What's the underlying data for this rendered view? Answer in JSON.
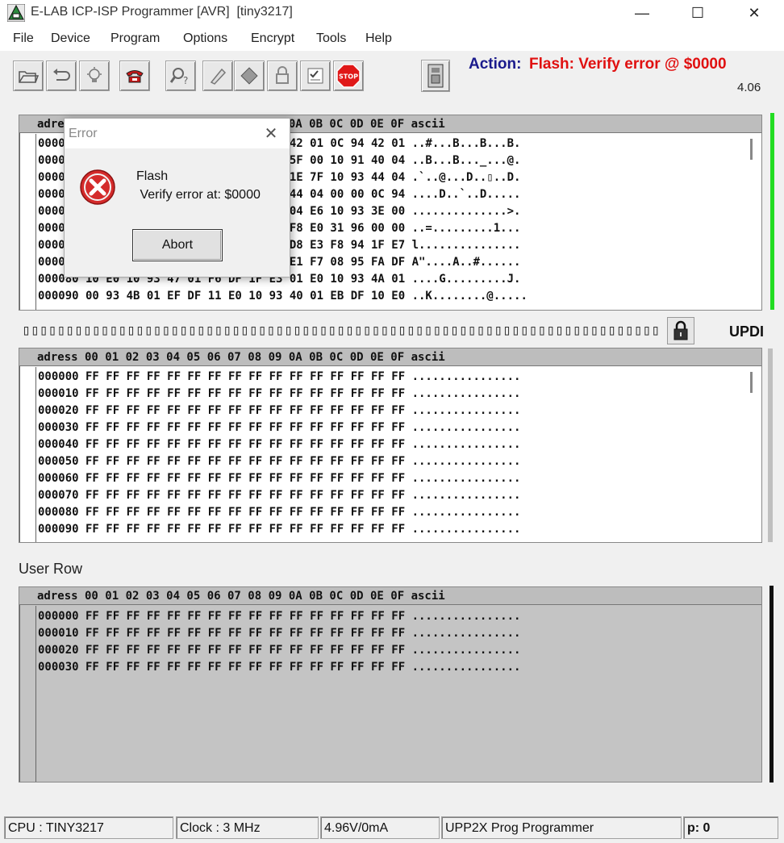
{
  "window": {
    "title": "E-LAB ICP-ISP Programmer [AVR]  [tiny3217]",
    "minimize_glyph": "—",
    "maximize_glyph": "☐",
    "close_glyph": "✕"
  },
  "menu": [
    "File",
    "Device",
    "Program",
    "Options",
    "Encrypt",
    "Tools",
    "Help"
  ],
  "toolbar": {
    "icons": [
      "open-file-icon",
      "reload-icon",
      "lightbulb-icon",
      "phone-icon",
      "search-device-icon",
      "pencil-erase-icon",
      "chip-icon",
      "padlock-icon",
      "checklist-icon",
      "stop-icon",
      "device-panel-icon"
    ],
    "stop_text": "STOP",
    "action_label": "Action:",
    "action_value": "Flash: Verify error @ $0000",
    "version": "4.06"
  },
  "colors": {
    "action_label": "#1a1a8c",
    "action_value": "#e01010",
    "status_ok": "#22dd22"
  },
  "flash_panel": {
    "header": "adress 00 01 02 03 04 05 06 07 08 09 0A 0B 0C 0D 0E 0F ascii",
    "rows": [
      "000000 0C 94 40 00 0C 94 42 01 0C 94 42 01 0C 94 42 01 ..#...B...B...B.",
      "000010 0C 94 42 01 0C 94 42 01 0C 94 5F 00 10 91 40 04 ..B...B..._...@.",
      "000020 0C 94 42 01 0C 94 40 04 44 04 1E 7F 10 93 44 04 .`..@...D..▯..D.",
      "000030 0C 94 42 01 0C 94 60 01 10 93 44 04 00 00 0C 94 ....D..`..D.....",
      "000040 0C 94 42 01 0C 94 42 01 18 E3 04 E6 10 93 3E 00 ..............>.",
      "000050 0C 94 42 01 3D 00 00 00 E0 E0 F8 E0 31 96 00 00 ..=.........1...",
      "000060 0C 94 42 01 0C 94 42 01 C9 ED D8 E3 F8 94 1F E7 l...............",
      "000070 0C 94 42 01 0C 94 42 01 00 23 E1 F7 08 95 FA DF A\"....A..#......",
      "000080 10 E0 10 93 47 01 F6 DF 1F E3 01 E0 10 93 4A 01 ....G.........J.",
      "000090 00 93 4B 01 EF DF 11 E0 10 93 40 01 EB DF 10 E0 ..K........@....."
    ]
  },
  "progress_text": "▯▯▯▯▯▯▯▯▯▯▯▯▯▯▯▯▯▯▯▯▯▯▯▯▯▯▯▯▯▯▯▯▯▯▯▯▯▯▯▯▯▯▯▯▯▯▯▯▯▯▯▯▯▯▯▯▯▯▯▯▯▯▯▯▯▯▯▯▯▯▯▯▯▯▯▯▯▯▯▯▯▯▯▯▯▯▯▯▯▯▯▯▯",
  "interface_label": "UPDI",
  "eeprom_panel": {
    "header": "adress 00 01 02 03 04 05 06 07 08 09 0A 0B 0C 0D 0E 0F ascii",
    "rows": [
      "000000 FF FF FF FF FF FF FF FF FF FF FF FF FF FF FF FF ................",
      "000010 FF FF FF FF FF FF FF FF FF FF FF FF FF FF FF FF ................",
      "000020 FF FF FF FF FF FF FF FF FF FF FF FF FF FF FF FF ................",
      "000030 FF FF FF FF FF FF FF FF FF FF FF FF FF FF FF FF ................",
      "000040 FF FF FF FF FF FF FF FF FF FF FF FF FF FF FF FF ................",
      "000050 FF FF FF FF FF FF FF FF FF FF FF FF FF FF FF FF ................",
      "000060 FF FF FF FF FF FF FF FF FF FF FF FF FF FF FF FF ................",
      "000070 FF FF FF FF FF FF FF FF FF FF FF FF FF FF FF FF ................",
      "000080 FF FF FF FF FF FF FF FF FF FF FF FF FF FF FF FF ................",
      "000090 FF FF FF FF FF FF FF FF FF FF FF FF FF FF FF FF ................"
    ]
  },
  "user_row": {
    "label": "User Row",
    "header": "adress 00 01 02 03 04 05 06 07 08 09 0A 0B 0C 0D 0E 0F ascii",
    "rows": [
      "000000 FF FF FF FF FF FF FF FF FF FF FF FF FF FF FF FF ................",
      "000010 FF FF FF FF FF FF FF FF FF FF FF FF FF FF FF FF ................",
      "000020 FF FF FF FF FF FF FF FF FF FF FF FF FF FF FF FF ................",
      "000030 FF FF FF FF FF FF FF FF FF FF FF FF FF FF FF FF ................"
    ]
  },
  "status": {
    "cpu": "CPU : TINY3217",
    "clock": "Clock : 3 MHz",
    "power": "4.96V/0mA",
    "programmer": "UPP2X Prog Programmer",
    "page": "p: 0"
  },
  "dialog": {
    "title": "Error",
    "close_glyph": "✕",
    "line1": "Flash",
    "line2": " Verify error at: $0000",
    "button": "Abort"
  }
}
